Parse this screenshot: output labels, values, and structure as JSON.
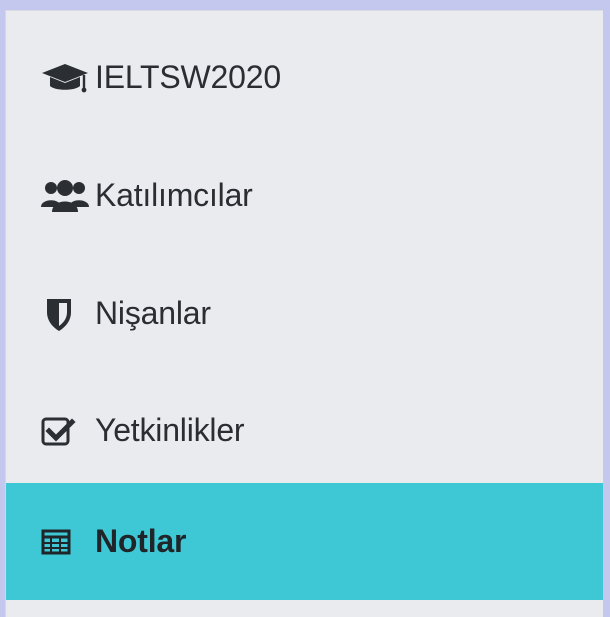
{
  "nav": {
    "items": [
      {
        "label": "IELTSW2020",
        "icon": "graduation-cap-icon",
        "active": false
      },
      {
        "label": "Katılımcılar",
        "icon": "users-icon",
        "active": false
      },
      {
        "label": "Nişanlar",
        "icon": "shield-icon",
        "active": false
      },
      {
        "label": "Yetkinlikler",
        "icon": "checkbox-icon",
        "active": false
      },
      {
        "label": "Notlar",
        "icon": "table-icon",
        "active": true
      }
    ]
  },
  "colors": {
    "background": "#e9ebee",
    "active": "#3ec8d6",
    "text": "#2a2d31",
    "outer": "#c5c8ee"
  }
}
